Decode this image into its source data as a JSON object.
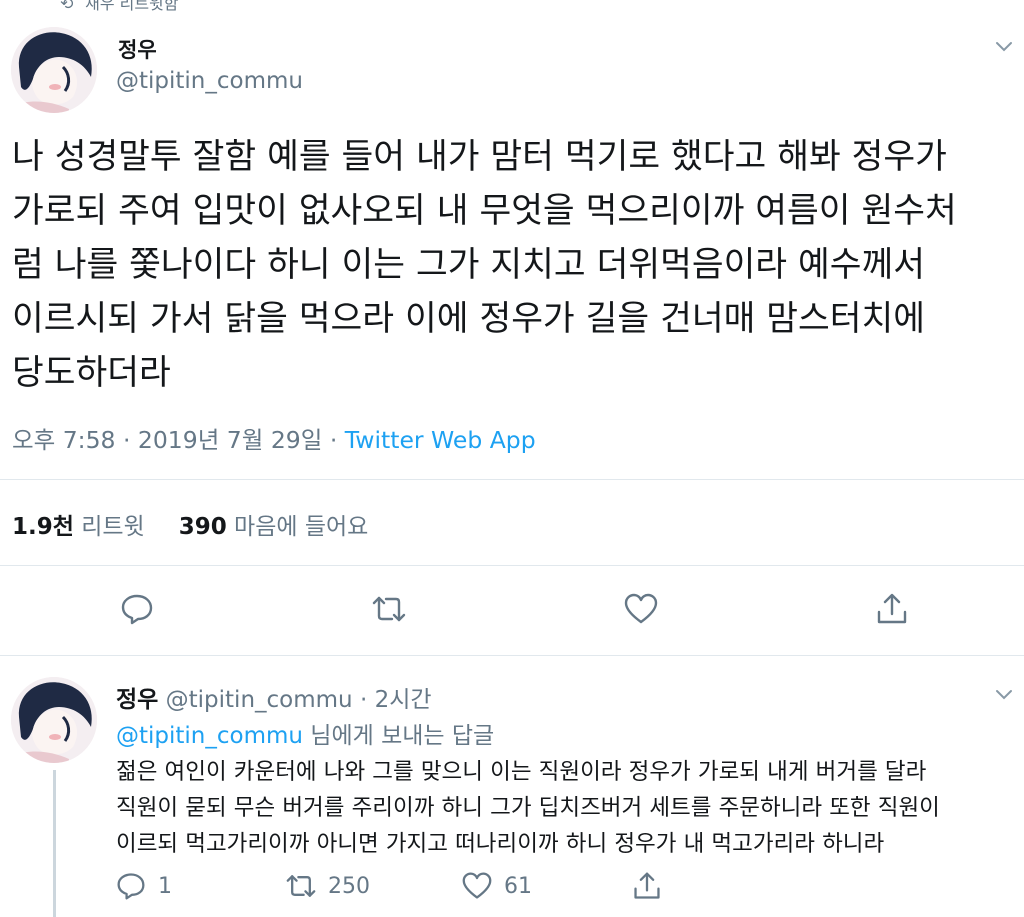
{
  "header_cut": {
    "text": "재우 리트윗함",
    "icon": "retweet-icon"
  },
  "tweet": {
    "name": "정우",
    "handle": "@tipitin_commu",
    "lines": [
      "나 성경말투 잘함 예를 들어 내가 맘터 먹기로 했다고 해봐 정우가",
      "가로되 주여 입맛이 없사오되 내 무엇을 먹으리이까 여름이 원수처",
      "럼 나를 쫓나이다 하니 이는 그가 지치고 더위먹음이라 예수께서",
      "이르시되 가서 닭을 먹으라 이에 정우가 길을 건너매 맘스터치에",
      "당도하더라"
    ],
    "meta": {
      "time": "오후 7:58",
      "sep": " · ",
      "date": "2019년 7월 29일",
      "app": "Twitter Web App"
    },
    "stats": {
      "retweets_count": "1.9천",
      "retweets_label": "리트윗",
      "likes_count": "390",
      "likes_label": "마음에 들어요"
    },
    "actions": [
      "reply-icon",
      "retweet-icon",
      "like-icon",
      "share-icon"
    ]
  },
  "reply": {
    "name": "정우",
    "handle": "@tipitin_commu",
    "sep": " · ",
    "time": "2시간",
    "replying_to_handle": "@tipitin_commu",
    "replying_to_suffix": " 님에게 보내는 답글",
    "lines": [
      "젊은 여인이 카운터에 나와 그를 맞으니 이는 직원이라 정우가 가로되 내게 버거를 달라",
      "직원이 묻되 무슨 버거를 주리이까 하니 그가 딥치즈버거 세트를 주문하니라 또한 직원이",
      "이르되 먹고가리이까 아니면 가지고 떠나리이까 하니 정우가 내 먹고가리라 하니라"
    ],
    "counts": {
      "replies": "1",
      "retweets": "250",
      "likes": "61"
    }
  },
  "colors": {
    "accent": "#1da1f2",
    "secondary": "#657786",
    "text": "#14171a",
    "divider": "#e1e8ed"
  }
}
